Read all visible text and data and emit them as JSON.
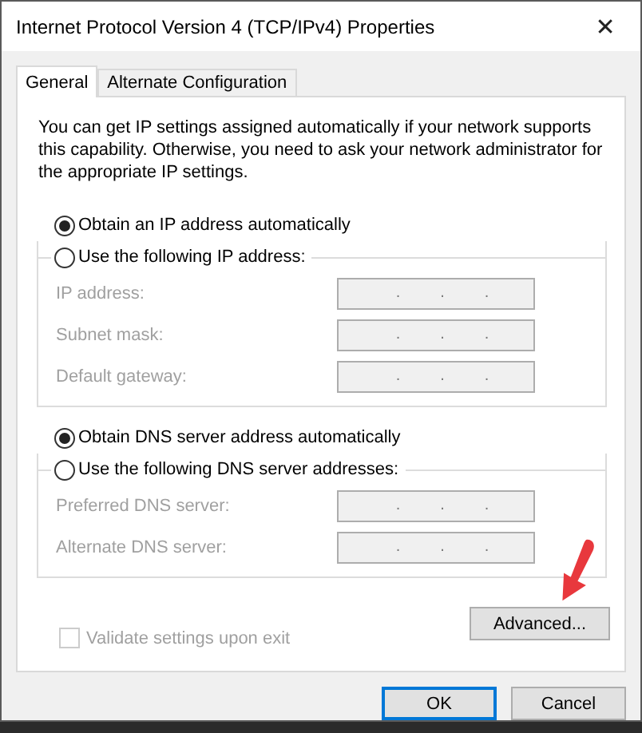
{
  "window": {
    "title": "Internet Protocol Version 4 (TCP/IPv4) Properties",
    "close": "✕"
  },
  "tabs": [
    {
      "label": "General",
      "selected": true
    },
    {
      "label": "Alternate Configuration",
      "selected": false
    }
  ],
  "description": "You can get IP settings assigned automatically if your network supports this capability. Otherwise, you need to ask your network administrator for the appropriate IP settings.",
  "sections": [
    {
      "auto": {
        "label": "Obtain an IP address automatically",
        "selected": true
      },
      "manual": {
        "label": "Use the following IP address:",
        "selected": false
      },
      "disabled": true,
      "fields": [
        {
          "label": "IP address:",
          "dots": [
            ".",
            ".",
            "."
          ]
        },
        {
          "label": "Subnet mask:",
          "dots": [
            ".",
            ".",
            "."
          ]
        },
        {
          "label": "Default gateway:",
          "dots": [
            ".",
            ".",
            "."
          ]
        }
      ]
    },
    {
      "auto": {
        "label": "Obtain DNS server address automatically",
        "selected": true
      },
      "manual": {
        "label": "Use the following DNS server addresses:",
        "selected": false
      },
      "disabled": true,
      "fields": [
        {
          "label": "Preferred DNS server:",
          "dots": [
            ".",
            ".",
            "."
          ]
        },
        {
          "label": "Alternate DNS server:",
          "dots": [
            ".",
            ".",
            "."
          ]
        }
      ]
    }
  ],
  "validate": {
    "label": "Validate settings upon exit",
    "checked": false,
    "disabled": true
  },
  "advanced_button": "Advanced...",
  "buttons": [
    {
      "label": "OK",
      "kind": "default"
    },
    {
      "label": "Cancel",
      "kind": "normal"
    }
  ]
}
